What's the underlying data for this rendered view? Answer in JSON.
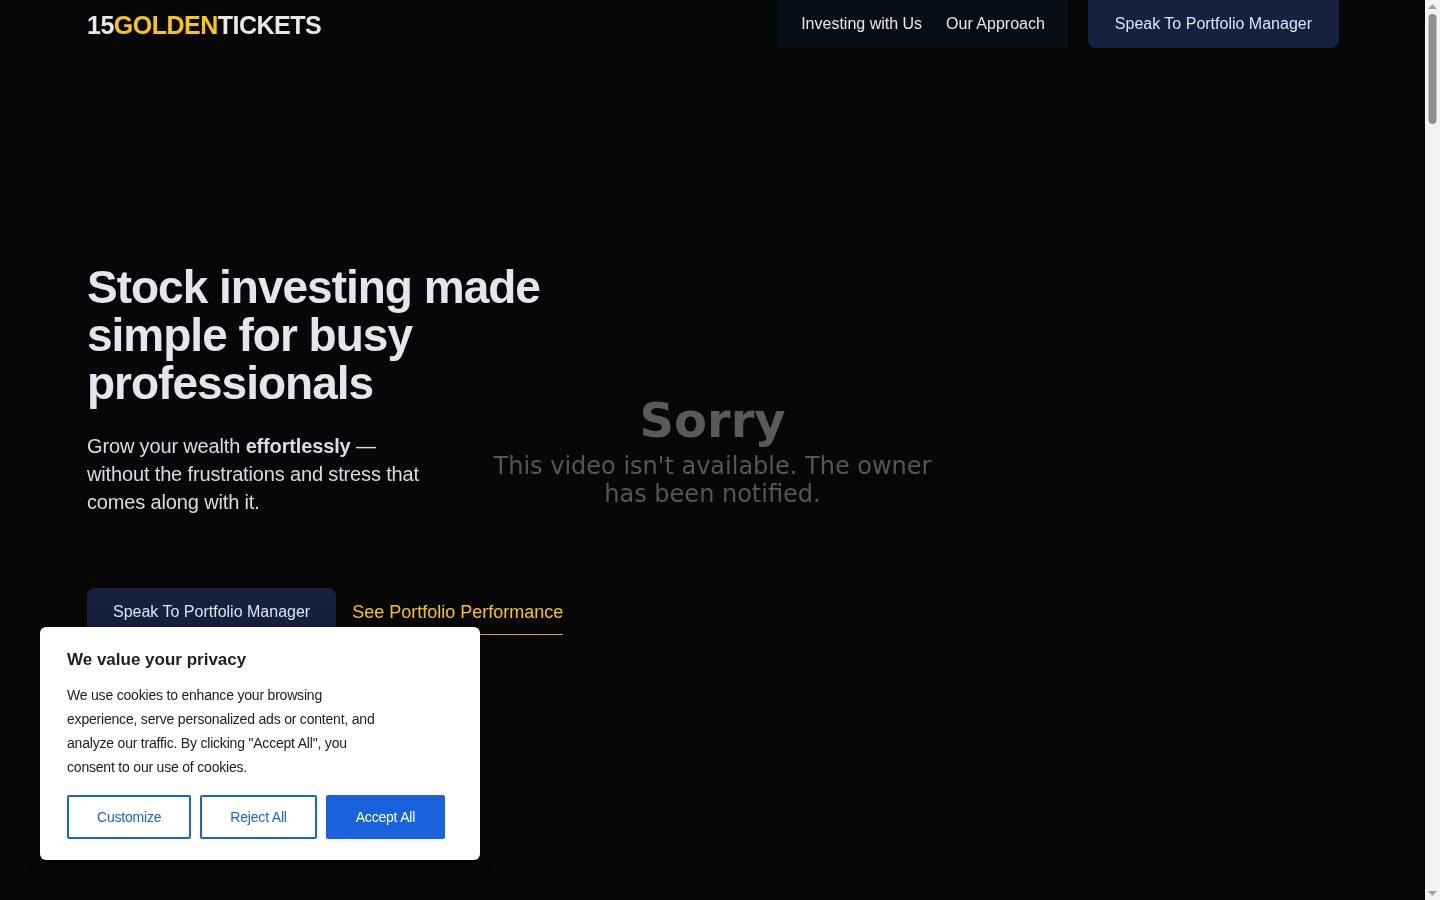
{
  "header": {
    "logo": {
      "parts": [
        {
          "text": "15",
          "kind": "plain"
        },
        {
          "text": "GOLDEN",
          "kind": "accent"
        },
        {
          "text": "TICKETS",
          "kind": "plain"
        }
      ]
    },
    "nav_links": [
      {
        "label": "Investing with Us"
      },
      {
        "label": "Our Approach"
      }
    ],
    "cta_button": {
      "label": "Speak To Portfolio Manager"
    }
  },
  "hero": {
    "headline": "Stock investing made simple for busy professionals",
    "subtitle": "Grow your wealth **effortlessly** — without the frustrations and stress that comes along with it.",
    "primary_button": {
      "label": "Speak To Portfolio Manager"
    },
    "secondary_link": {
      "label": "See Portfolio Performance"
    }
  },
  "video_embed": {
    "title": "Sorry",
    "message": "This video isn't available. The owner has been notified."
  },
  "cookie_banner": {
    "title": "We value your privacy",
    "text": "We use cookies to enhance your browsing experience, serve personalized ads or content, and analyze our traffic. By clicking \"Accept All\", you consent to our use of cookies.",
    "buttons": [
      {
        "label": "Customize",
        "kind": "outline"
      },
      {
        "label": "Reject All",
        "kind": "outline"
      },
      {
        "label": "Accept All",
        "kind": "filled"
      }
    ]
  }
}
